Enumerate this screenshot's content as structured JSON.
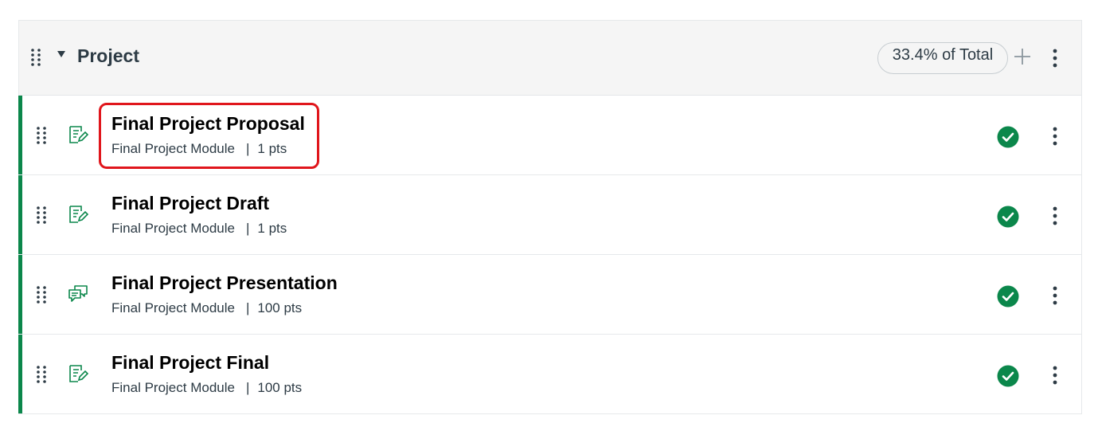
{
  "group": {
    "title": "Project",
    "weight_label": "33.4% of Total",
    "icons": {
      "drag": "drag-handle-icon",
      "collapse": "caret-down-icon",
      "add": "plus-icon",
      "menu": "kebab-menu-icon"
    }
  },
  "items": [
    {
      "title": "Final Project Proposal",
      "module": "Final Project Module",
      "separator": "|",
      "points": "1 pts",
      "type_icon": "assignment-icon",
      "status_icon": "published-check-icon"
    },
    {
      "title": "Final Project Draft",
      "module": "Final Project Module",
      "separator": "|",
      "points": "1 pts",
      "type_icon": "assignment-icon",
      "status_icon": "published-check-icon"
    },
    {
      "title": "Final Project Presentation",
      "module": "Final Project Module",
      "separator": "|",
      "points": "100 pts",
      "type_icon": "discussion-icon",
      "status_icon": "published-check-icon"
    },
    {
      "title": "Final Project Final",
      "module": "Final Project Module",
      "separator": "|",
      "points": "100 pts",
      "type_icon": "assignment-icon",
      "status_icon": "published-check-icon"
    }
  ],
  "colors": {
    "accent": "#0b874b",
    "highlight": "#e0161c",
    "header_bg": "#f5f5f5",
    "text": "#2d3b45"
  }
}
